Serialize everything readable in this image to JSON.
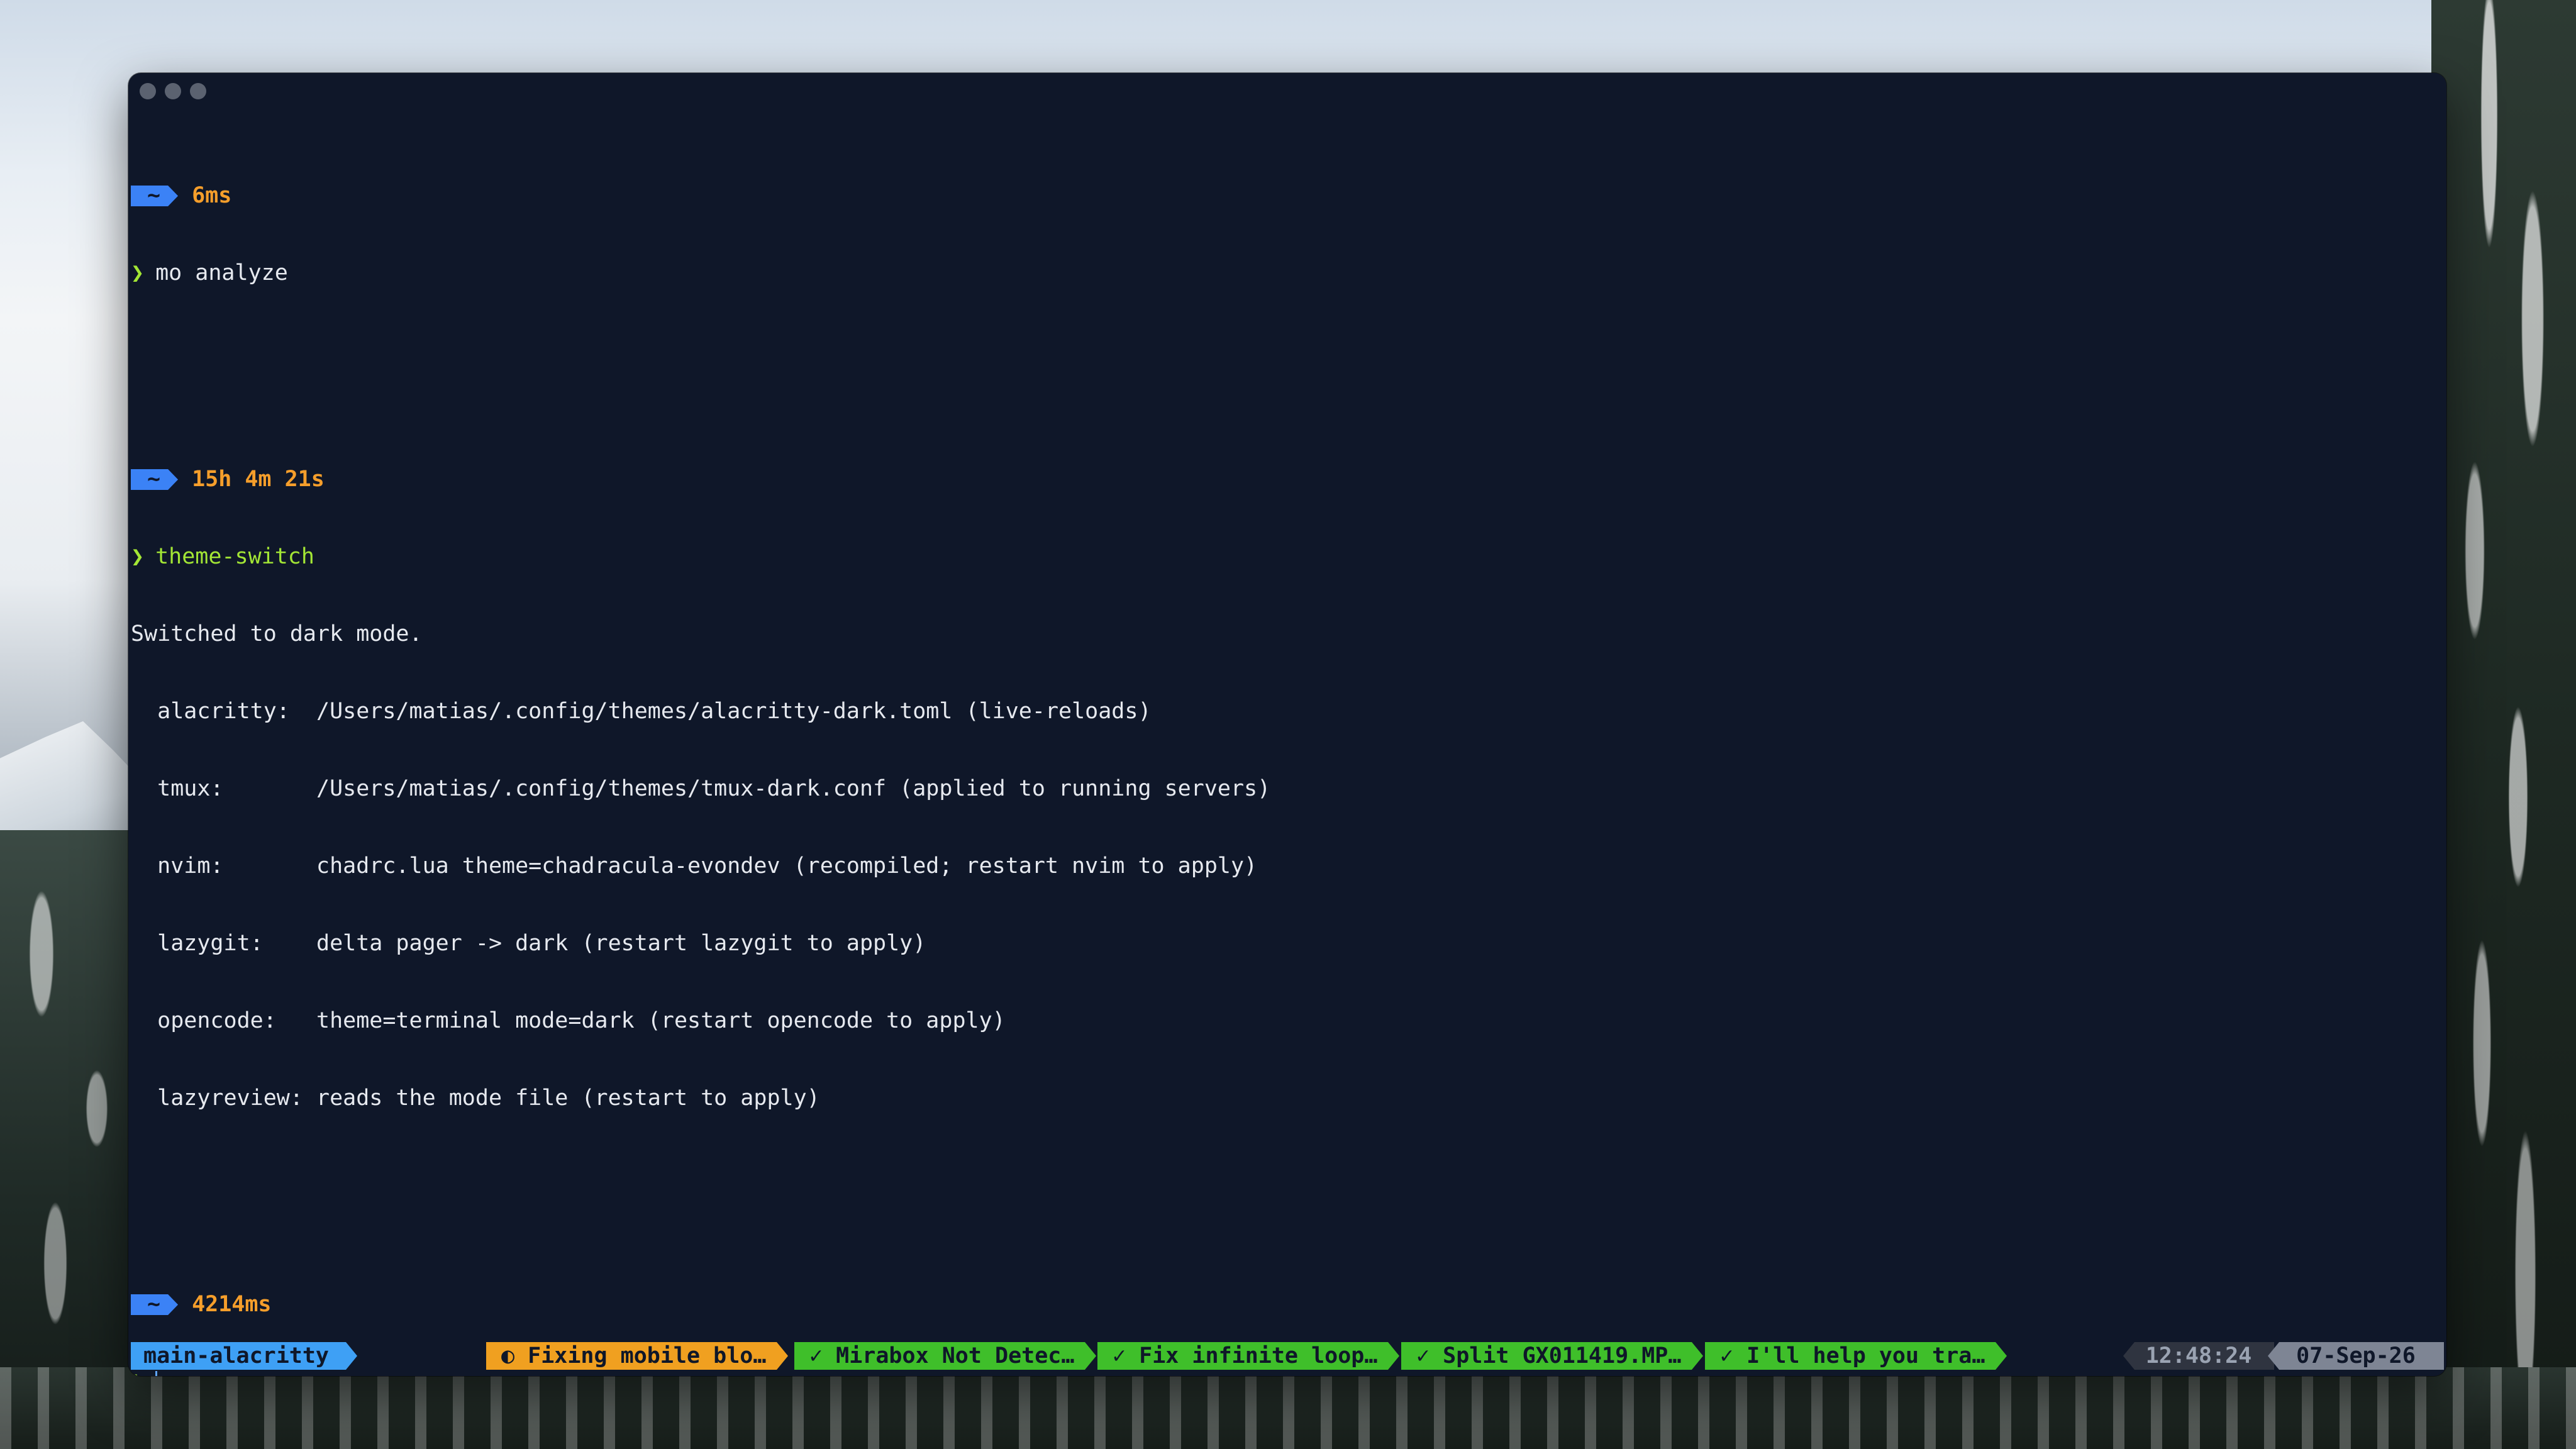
{
  "prompt_home": "~",
  "blocks": [
    {
      "duration": "6ms",
      "prompt_symbol": "❯",
      "command": "mo analyze"
    },
    {
      "duration": "15h 4m 21s",
      "prompt_symbol": "❯",
      "command": "theme-switch"
    },
    {
      "duration": "4214ms",
      "prompt_symbol": "❯",
      "command": ""
    }
  ],
  "output": {
    "header": "Switched to dark mode.",
    "lines": [
      "  alacritty:  /Users/matias/.config/themes/alacritty-dark.toml (live-reloads)",
      "  tmux:       /Users/matias/.config/themes/tmux-dark.conf (applied to running servers)",
      "  nvim:       chadrc.lua theme=chadracula-evondev (recompiled; restart nvim to apply)",
      "  lazygit:    delta pager -> dark (restart lazygit to apply)",
      "  opencode:   theme=terminal mode=dark (restart opencode to apply)",
      "  lazyreview: reads the mode file (restart to apply)"
    ]
  },
  "statusbar": {
    "session": "main-alacritty",
    "windows": [
      {
        "label": "◐ Fixing mobile blo…",
        "state": "orange"
      },
      {
        "label": "✓ Mirabox Not Detec…",
        "state": "green"
      },
      {
        "label": "✓ Fix infinite loop…",
        "state": "green"
      },
      {
        "label": "✓ Split GX011419.MP…",
        "state": "green"
      },
      {
        "label": "✓ I'll help you tra…",
        "state": "green"
      }
    ],
    "time": "12:48:24",
    "date": "07-Sep-26"
  },
  "colors": {
    "terminal_bg": "#0f1729",
    "prompt_blue": "#3b82f6",
    "duration_orange": "#f59e2b",
    "prompt_green": "#a3e635",
    "status_green": "#3fbf2a",
    "status_orange": "#f0a020"
  }
}
